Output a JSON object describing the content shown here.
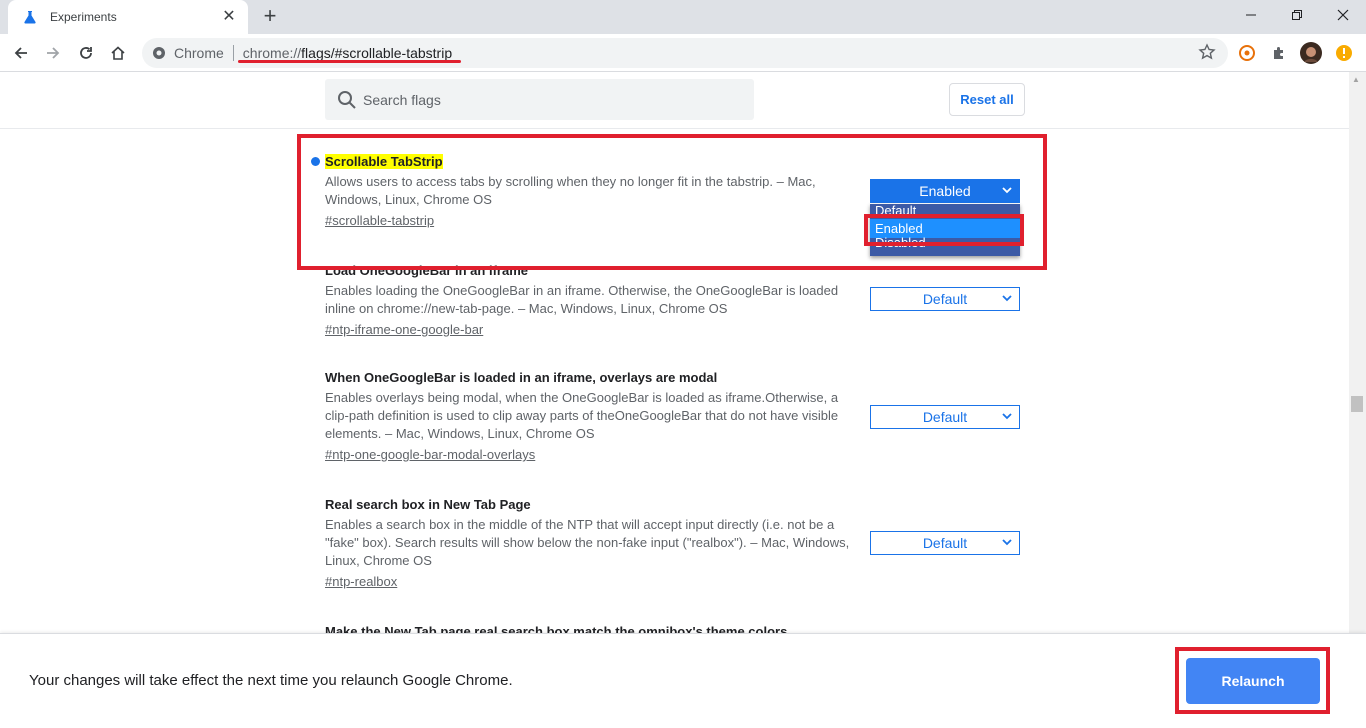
{
  "browser": {
    "tab_title": "Experiments",
    "site_label": "Chrome",
    "url_scheme": "chrome://",
    "url_path": "flags/#scrollable-tabstrip",
    "accent_color": "#1a73e8",
    "highlight_color": "#e0202e"
  },
  "header": {
    "search_placeholder": "Search flags",
    "reset_label": "Reset all"
  },
  "experiments": [
    {
      "title": "Scrollable TabStrip",
      "description": "Allows users to access tabs by scrolling when they no longer fit in the tabstrip. – Mac, Windows, Linux, Chrome OS",
      "link": "#scrollable-tabstrip",
      "value": "Enabled",
      "options": [
        "Default",
        "Enabled",
        "Disabled"
      ],
      "selected_option": "Enabled"
    },
    {
      "title": "Load OneGoogleBar in an iframe",
      "description": "Enables loading the OneGoogleBar in an iframe. Otherwise, the OneGoogleBar is loaded inline on chrome://new-tab-page. – Mac, Windows, Linux, Chrome OS",
      "link": "#ntp-iframe-one-google-bar",
      "value": "Default"
    },
    {
      "title": "When OneGoogleBar is loaded in an iframe, overlays are modal",
      "description": "Enables overlays being modal, when the OneGoogleBar is loaded as iframe.Otherwise, a clip-path definition is used to clip away parts of theOneGoogleBar that do not have visible elements. – Mac, Windows, Linux, Chrome OS",
      "link": "#ntp-one-google-bar-modal-overlays",
      "value": "Default"
    },
    {
      "title": "Real search box in New Tab Page",
      "description": "Enables a search box in the middle of the NTP that will accept input directly (i.e. not be a \"fake\" box). Search results will show below the non-fake input (\"realbox\"). – Mac, Windows, Linux, Chrome OS",
      "link": "#ntp-realbox",
      "value": "Default"
    },
    {
      "title": "Make the New Tab page real search box match the omnibox's theme colors"
    }
  ],
  "footer": {
    "message": "Your changes will take effect the next time you relaunch Google Chrome.",
    "relaunch_label": "Relaunch"
  }
}
